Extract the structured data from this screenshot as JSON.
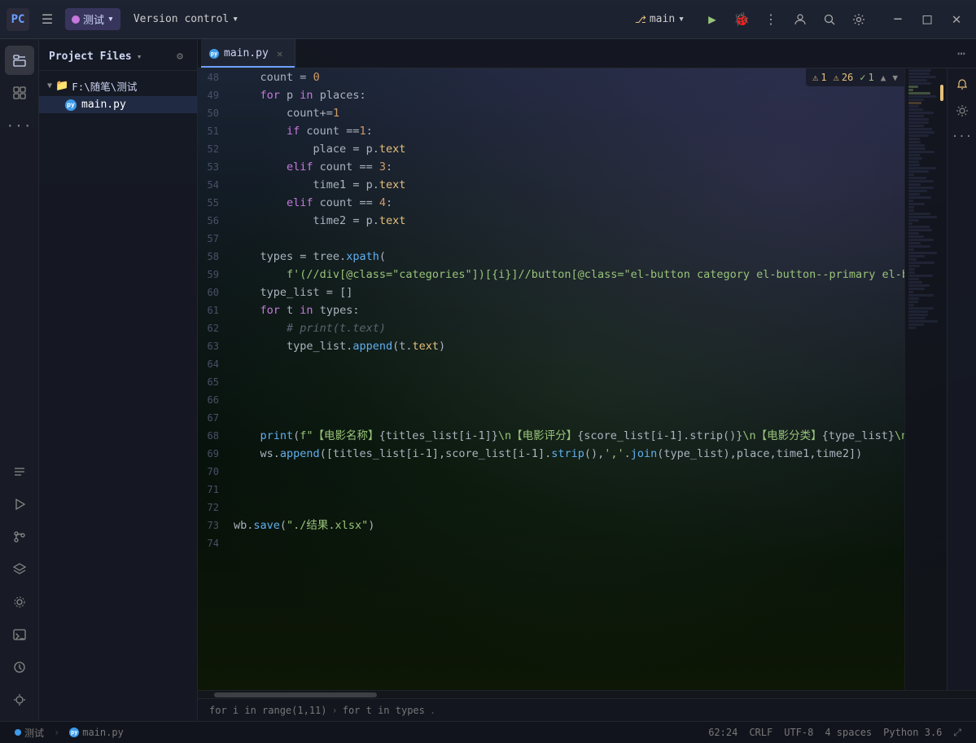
{
  "titleBar": {
    "logoText": "PC",
    "menuBtnLabel": "☰",
    "projectName": "测试",
    "projectDropdown": "▾",
    "vcsLabel": "Version control",
    "vcsDropdown": "▾",
    "branchName": "main",
    "branchDropdown": "▾",
    "runBtn": "▶",
    "debugBtn": "🐛",
    "moreBtn": "⋮",
    "profileBtn": "👤",
    "searchBtn": "🔍",
    "settingsBtn": "⚙",
    "minimizeBtn": "−",
    "maximizeBtn": "□",
    "closeBtn": "✕"
  },
  "filePanel": {
    "title": "Project Files",
    "dropdownIcon": "▾",
    "gearIcon": "⚙",
    "folderName": "F:\\随笔\\测试",
    "files": [
      {
        "name": "main.py",
        "type": "python"
      }
    ]
  },
  "tabBar": {
    "tabs": [
      {
        "name": "main.py",
        "active": true
      }
    ],
    "moreBtn": "⋯"
  },
  "diagnostics": {
    "warnings": "1",
    "infos": "26",
    "ok": "1"
  },
  "breadcrumb": {
    "part1": "for i in range(1,11)",
    "arrow": "›",
    "part2": "for t in types",
    "dot": "."
  },
  "statusBar": {
    "projectName": "测试",
    "fileName": "main.py",
    "position": "62:24",
    "lineEnding": "CRLF",
    "encoding": "UTF-8",
    "indent": "4 spaces",
    "language": "Python 3.6",
    "expandIcon": "⤢"
  },
  "codeLines": [
    {
      "num": "48",
      "content": "    count = 0",
      "tokens": [
        {
          "text": "    count ",
          "cls": "cn"
        },
        {
          "text": "=",
          "cls": "op"
        },
        {
          "text": " ",
          "cls": "cn"
        },
        {
          "text": "0",
          "cls": "num"
        }
      ]
    },
    {
      "num": "49",
      "content": "    for p in places:",
      "tokens": [
        {
          "text": "    ",
          "cls": "cn"
        },
        {
          "text": "for",
          "cls": "kw"
        },
        {
          "text": " p ",
          "cls": "cn"
        },
        {
          "text": "in",
          "cls": "kw"
        },
        {
          "text": " places:",
          "cls": "cn"
        }
      ]
    },
    {
      "num": "50",
      "content": "        count+=1",
      "tokens": [
        {
          "text": "        count",
          "cls": "cn"
        },
        {
          "text": "+=",
          "cls": "op"
        },
        {
          "text": "1",
          "cls": "num"
        }
      ]
    },
    {
      "num": "51",
      "content": "        if count ==1:",
      "tokens": [
        {
          "text": "        ",
          "cls": "cn"
        },
        {
          "text": "if",
          "cls": "kw"
        },
        {
          "text": " count ",
          "cls": "cn"
        },
        {
          "text": "==",
          "cls": "op"
        },
        {
          "text": "1",
          "cls": "num"
        },
        {
          "text": ":",
          "cls": "cn"
        }
      ]
    },
    {
      "num": "52",
      "content": "            place = p.text",
      "tokens": [
        {
          "text": "            place ",
          "cls": "cn"
        },
        {
          "text": "=",
          "cls": "op"
        },
        {
          "text": " p.",
          "cls": "cn"
        },
        {
          "text": "text",
          "cls": "attr"
        }
      ]
    },
    {
      "num": "53",
      "content": "        elif count == 3:",
      "tokens": [
        {
          "text": "        ",
          "cls": "cn"
        },
        {
          "text": "elif",
          "cls": "kw"
        },
        {
          "text": " count ",
          "cls": "cn"
        },
        {
          "text": "==",
          "cls": "op"
        },
        {
          "text": " ",
          "cls": "cn"
        },
        {
          "text": "3",
          "cls": "num"
        },
        {
          "text": ":",
          "cls": "cn"
        }
      ]
    },
    {
      "num": "54",
      "content": "            time1 = p.text",
      "tokens": [
        {
          "text": "            time1 ",
          "cls": "cn"
        },
        {
          "text": "=",
          "cls": "op"
        },
        {
          "text": " p.",
          "cls": "cn"
        },
        {
          "text": "text",
          "cls": "attr"
        }
      ]
    },
    {
      "num": "55",
      "content": "        elif count == 4:",
      "tokens": [
        {
          "text": "        ",
          "cls": "cn"
        },
        {
          "text": "elif",
          "cls": "kw"
        },
        {
          "text": " count ",
          "cls": "cn"
        },
        {
          "text": "==",
          "cls": "op"
        },
        {
          "text": " ",
          "cls": "cn"
        },
        {
          "text": "4",
          "cls": "num"
        },
        {
          "text": ":",
          "cls": "cn"
        }
      ]
    },
    {
      "num": "56",
      "content": "            time2 = p.text",
      "tokens": [
        {
          "text": "            time2 ",
          "cls": "cn"
        },
        {
          "text": "=",
          "cls": "op"
        },
        {
          "text": " p.",
          "cls": "cn"
        },
        {
          "text": "text",
          "cls": "attr"
        }
      ]
    },
    {
      "num": "57",
      "content": ""
    },
    {
      "num": "58",
      "content": "    types = tree.xpath(",
      "tokens": [
        {
          "text": "    types ",
          "cls": "cn"
        },
        {
          "text": "=",
          "cls": "op"
        },
        {
          "text": " tree.",
          "cls": "cn"
        },
        {
          "text": "xpath",
          "cls": "fn"
        },
        {
          "text": "(",
          "cls": "cn"
        }
      ]
    },
    {
      "num": "59",
      "content": "        f'(//div[@class=\"categories\"])[{i}]//button[@class=\"el-button category el-button--primary el-button-",
      "tokens": [
        {
          "text": "        ",
          "cls": "cn"
        },
        {
          "text": "f'(//div[@class=\"categories\"])[{i}]//button[@class=\"el-button category el-button--primary el-button-",
          "cls": "str"
        }
      ]
    },
    {
      "num": "60",
      "content": "    type_list = []",
      "tokens": [
        {
          "text": "    type_list ",
          "cls": "cn"
        },
        {
          "text": "=",
          "cls": "op"
        },
        {
          "text": " []",
          "cls": "cn"
        }
      ]
    },
    {
      "num": "61",
      "content": "    for t in types:",
      "tokens": [
        {
          "text": "    ",
          "cls": "cn"
        },
        {
          "text": "for",
          "cls": "kw"
        },
        {
          "text": " t ",
          "cls": "cn"
        },
        {
          "text": "in",
          "cls": "kw"
        },
        {
          "text": " types:",
          "cls": "cn"
        }
      ]
    },
    {
      "num": "62",
      "content": "        # print(t.text)",
      "tokens": [
        {
          "text": "        ",
          "cls": "cn"
        },
        {
          "text": "# print(t.text)",
          "cls": "comment"
        }
      ]
    },
    {
      "num": "63",
      "content": "        type_list.append(t.text)",
      "tokens": [
        {
          "text": "        type_list.",
          "cls": "cn"
        },
        {
          "text": "append",
          "cls": "fn"
        },
        {
          "text": "(t.",
          "cls": "cn"
        },
        {
          "text": "text",
          "cls": "attr"
        },
        {
          "text": ")",
          "cls": "cn"
        }
      ]
    },
    {
      "num": "64",
      "content": ""
    },
    {
      "num": "65",
      "content": ""
    },
    {
      "num": "66",
      "content": ""
    },
    {
      "num": "67",
      "content": ""
    },
    {
      "num": "68",
      "content": "    print(f\"【电影名称】{titles_list[i-1]}\\n【电影评分】{score_list[i-1].strip()}\\n【电影分类】{type_list}\\n【上映地",
      "tokens": [
        {
          "text": "    ",
          "cls": "cn"
        },
        {
          "text": "print",
          "cls": "fn"
        },
        {
          "text": "(",
          "cls": "cn"
        },
        {
          "text": "f\"",
          "cls": "str"
        },
        {
          "text": "【电影名称】",
          "cls": "chinese"
        },
        {
          "text": "{titles_list[i-1]}",
          "cls": "cn"
        },
        {
          "text": "\\n",
          "cls": "str"
        },
        {
          "text": "【电影评分】",
          "cls": "chinese"
        },
        {
          "text": "{score_list[i-1].strip()}",
          "cls": "cn"
        },
        {
          "text": "\\n",
          "cls": "str"
        },
        {
          "text": "【电影分类】",
          "cls": "chinese"
        },
        {
          "text": "{type_list}",
          "cls": "cn"
        },
        {
          "text": "\\n【上映地",
          "cls": "str"
        }
      ]
    },
    {
      "num": "69",
      "content": "    ws.append([titles_list[i-1],score_list[i-1].strip(),','.join(type_list),place,time1,time2])",
      "tokens": [
        {
          "text": "    ws.",
          "cls": "cn"
        },
        {
          "text": "append",
          "cls": "fn"
        },
        {
          "text": "([titles_list[i",
          "cls": "cn"
        },
        {
          "text": "-",
          "cls": "op"
        },
        {
          "text": "1],score_list[i",
          "cls": "cn"
        },
        {
          "text": "-",
          "cls": "op"
        },
        {
          "text": "1].",
          "cls": "cn"
        },
        {
          "text": "strip",
          "cls": "fn"
        },
        {
          "text": "(),",
          "cls": "cn"
        },
        {
          "text": "','",
          "cls": "str"
        },
        {
          "text": ".",
          "cls": "cn"
        },
        {
          "text": "join",
          "cls": "fn"
        },
        {
          "text": "(type_list),place,time1,time2])",
          "cls": "cn"
        }
      ]
    },
    {
      "num": "70",
      "content": ""
    },
    {
      "num": "71",
      "content": ""
    },
    {
      "num": "72",
      "content": ""
    },
    {
      "num": "73",
      "content": "wb.save(\"./结果.xlsx\")",
      "tokens": [
        {
          "text": "wb.",
          "cls": "cn"
        },
        {
          "text": "save",
          "cls": "fn"
        },
        {
          "text": "(",
          "cls": "cn"
        },
        {
          "text": "\"./结果.xlsx\"",
          "cls": "str"
        },
        {
          "text": ")",
          "cls": "cn"
        }
      ]
    },
    {
      "num": "74",
      "content": ""
    }
  ],
  "iconSidebar": {
    "items": [
      {
        "id": "folder",
        "icon": "📁",
        "active": true
      },
      {
        "id": "structure",
        "icon": "⊞",
        "active": false
      },
      {
        "id": "more",
        "icon": "⋯",
        "active": false
      }
    ],
    "bottomItems": [
      {
        "id": "list",
        "icon": "≡"
      },
      {
        "id": "run",
        "icon": "▶"
      },
      {
        "id": "console",
        "icon": "⌥"
      },
      {
        "id": "layers",
        "icon": "◫"
      },
      {
        "id": "stream",
        "icon": "⊙"
      },
      {
        "id": "terminal",
        "icon": ">_"
      },
      {
        "id": "clock",
        "icon": "🕐"
      },
      {
        "id": "git",
        "icon": "⎇"
      }
    ]
  }
}
